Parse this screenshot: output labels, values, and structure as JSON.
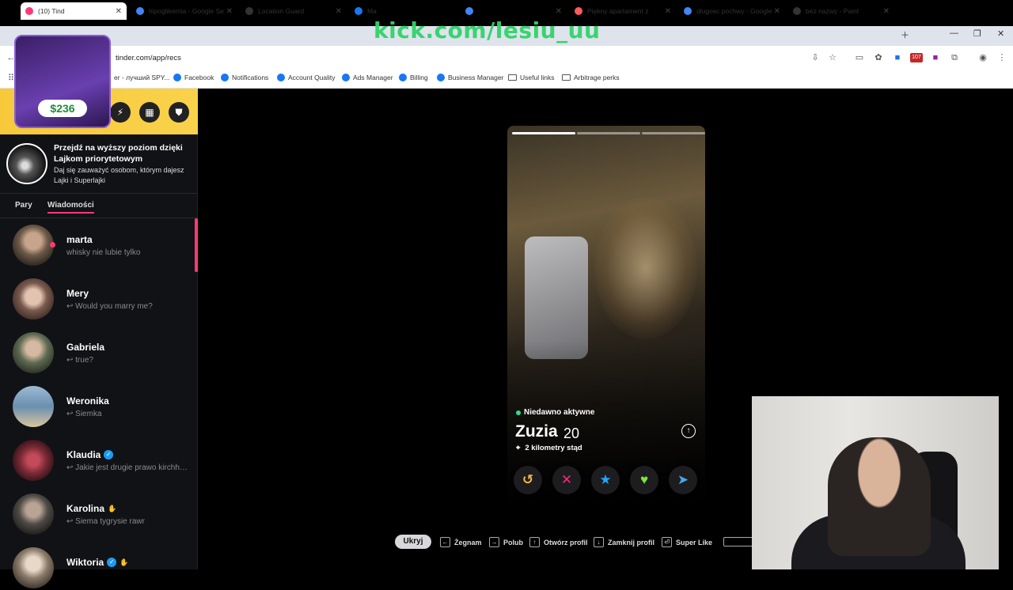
{
  "watermark": "kick.com/lesiu_uu",
  "tabs": [
    {
      "label": "(10) Tind",
      "icon": "tinder-icon",
      "color": "#fd3a73"
    },
    {
      "label": "hipoglikemia - Google Se",
      "icon": "google-icon",
      "color": "#4285f4"
    },
    {
      "label": "Location Guard",
      "icon": "location-icon",
      "color": "#333333"
    },
    {
      "label": "Ma",
      "icon": "facebook-icon",
      "color": "#1877f2"
    },
    {
      "label": "",
      "icon": "google-icon",
      "color": "#4285f4"
    },
    {
      "label": "Piękny apartament z",
      "icon": "airbnb-icon",
      "color": "#ff5a5f"
    },
    {
      "label": "dlugosc pochwy - Google",
      "icon": "google-icon",
      "color": "#4285f4"
    },
    {
      "label": "bez nazwy - Paint",
      "icon": "paint-icon",
      "color": "#333333"
    }
  ],
  "address": "tinder.com/app/recs",
  "extension_badge": "107",
  "bookmarks": [
    {
      "label": "er - лучший SPY...",
      "type": "site"
    },
    {
      "label": "Facebook",
      "type": "fb"
    },
    {
      "label": "Notifications",
      "type": "fb"
    },
    {
      "label": "Account Quality",
      "type": "fb"
    },
    {
      "label": "Ads Manager",
      "type": "fb"
    },
    {
      "label": "Billing",
      "type": "fb"
    },
    {
      "label": "Business Manager",
      "type": "fb"
    },
    {
      "label": "Useful links",
      "type": "folder"
    },
    {
      "label": "Arbitrage perks",
      "type": "folder"
    }
  ],
  "overlay": {
    "price": "$236"
  },
  "promo": {
    "title": "Przejdź na wyższy poziom dzięki Lajkom priorytetowym",
    "subtitle": "Daj się zauważyć osobom, którym dajesz Lajki i Superlajki"
  },
  "sidebar_tabs": {
    "matches": "Pary",
    "messages": "Wiadomości"
  },
  "messages": [
    {
      "name": "marta",
      "preview": "whisky nie lubie tylko",
      "verified": false,
      "emoji": false,
      "unread": true,
      "color": "#6b5848"
    },
    {
      "name": "Mery",
      "preview": "↩ Would you marry me?",
      "verified": false,
      "emoji": false,
      "unread": false,
      "color": "#7a5a4e"
    },
    {
      "name": "Gabriela",
      "preview": "↩ true?",
      "verified": false,
      "emoji": false,
      "unread": false,
      "color": "#5e6a52"
    },
    {
      "name": "Weronika",
      "preview": "↩ Siemka",
      "verified": false,
      "emoji": false,
      "unread": false,
      "color": "#6a8fb0"
    },
    {
      "name": "Klaudia",
      "preview": "↩ Jakie jest drugie prawo kirchhoffa?",
      "verified": true,
      "emoji": false,
      "unread": false,
      "color": "#7a2a35"
    },
    {
      "name": "Karolina",
      "preview": "↩ Siema tygrysie rawr",
      "verified": false,
      "emoji": true,
      "unread": false,
      "color": "#4e4a46"
    },
    {
      "name": "Wiktoria",
      "preview": "",
      "verified": true,
      "emoji": true,
      "unread": false,
      "color": "#8a7a6a"
    }
  ],
  "profile": {
    "status": "Niedawno aktywne",
    "name": "Zuzia",
    "age": "20",
    "distance": "2 kilometry stąd",
    "photos_total": 3,
    "photo_current": 1
  },
  "actions": [
    {
      "name": "rewind-button",
      "glyph": "↺",
      "color": "#f5b748"
    },
    {
      "name": "nope-button",
      "glyph": "✕",
      "color": "#fd267d"
    },
    {
      "name": "super-like-button",
      "glyph": "★",
      "color": "#1ea7fd"
    },
    {
      "name": "like-button",
      "glyph": "♥",
      "color": "#7ee23b"
    },
    {
      "name": "boost-button",
      "glyph": "➤",
      "color": "#45a8e6"
    }
  ],
  "shortcuts": {
    "hide": "Ukryj",
    "nope": "Żegnam",
    "like": "Polub",
    "open": "Otwórz profil",
    "close": "Zamknij profil",
    "super": "Super Like"
  }
}
